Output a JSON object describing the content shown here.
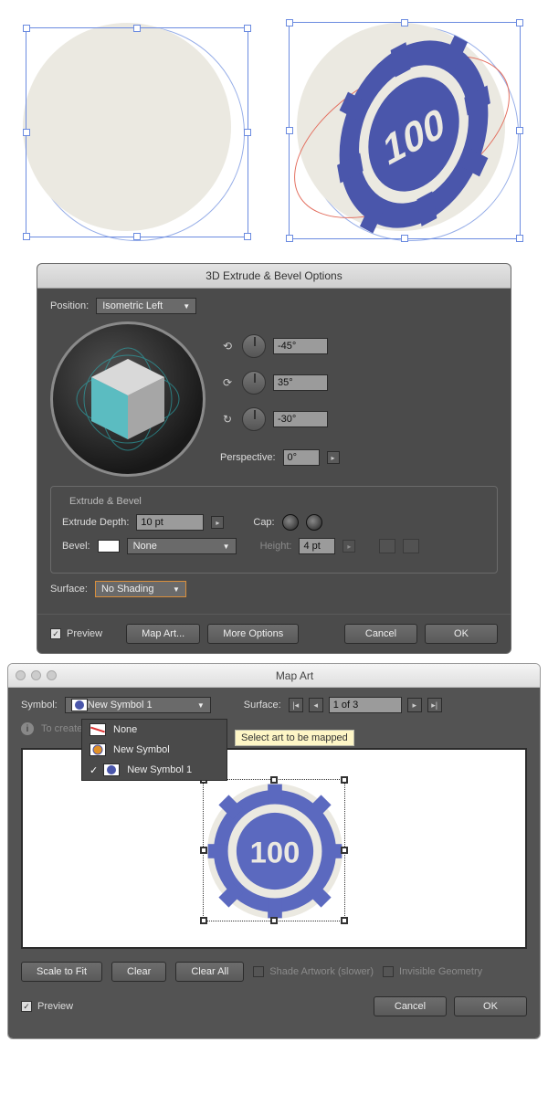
{
  "canvas": {
    "chip_text": "100"
  },
  "extrude": {
    "title": "3D Extrude & Bevel Options",
    "position_label": "Position:",
    "position_value": "Isometric Left",
    "rot_x": "-45°",
    "rot_y": "35°",
    "rot_z": "-30°",
    "perspective_label": "Perspective:",
    "perspective_value": "0°",
    "group_title": "Extrude & Bevel",
    "depth_label": "Extrude Depth:",
    "depth_value": "10 pt",
    "cap_label": "Cap:",
    "bevel_label": "Bevel:",
    "bevel_value": "None",
    "height_label": "Height:",
    "height_value": "4 pt",
    "surface_label": "Surface:",
    "surface_value": "No Shading",
    "preview_label": "Preview",
    "map_art_btn": "Map Art...",
    "more_btn": "More Options",
    "cancel_btn": "Cancel",
    "ok_btn": "OK"
  },
  "mapart": {
    "title": "Map Art",
    "symbol_label": "Symbol:",
    "symbol_value": "New Symbol 1",
    "options": {
      "none": "None",
      "sym": "New Symbol",
      "sym1": "New Symbol 1"
    },
    "surface_label": "Surface:",
    "surface_value": "1 of 3",
    "tooltip": "Select art to be mapped",
    "hint": "To create",
    "scale_btn": "Scale to Fit",
    "clear_btn": "Clear",
    "clearall_btn": "Clear All",
    "shade_label": "Shade Artwork (slower)",
    "invis_label": "Invisible Geometry",
    "preview_label": "Preview",
    "cancel_btn": "Cancel",
    "ok_btn": "OK",
    "chip_text": "100"
  }
}
